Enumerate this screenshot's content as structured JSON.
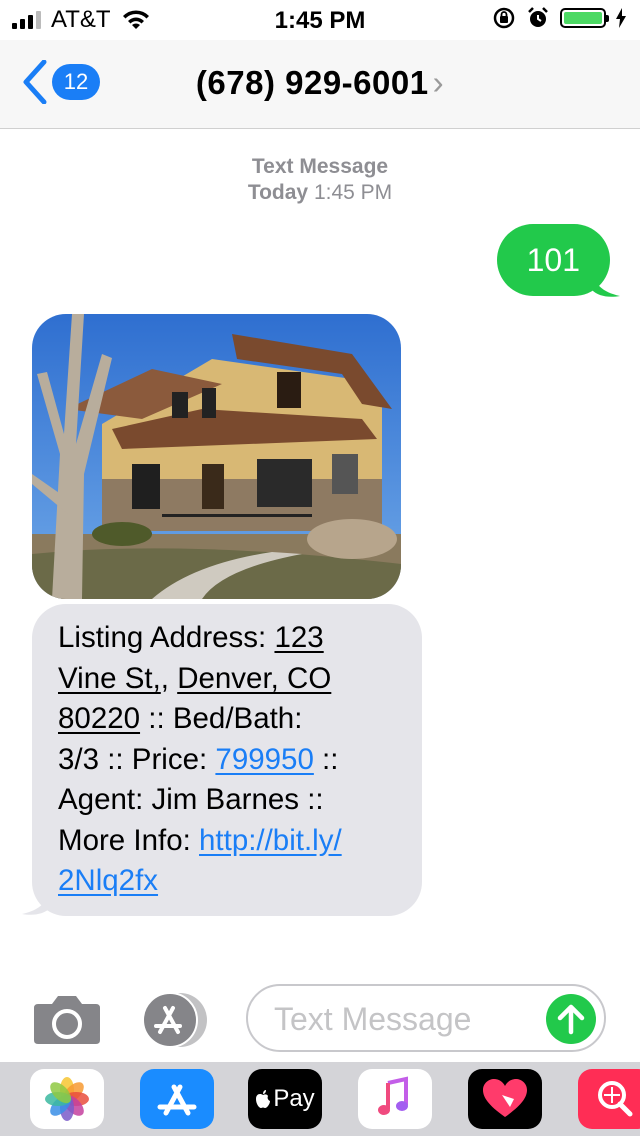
{
  "status_bar": {
    "carrier": "AT&T",
    "time": "1:45 PM",
    "battery_color": "#4cd964"
  },
  "nav": {
    "back_count": "12",
    "contact": "(678) 929-6001",
    "chevron": "›"
  },
  "timestamp": {
    "label": "Text Message",
    "day": "Today",
    "time": "1:45 PM"
  },
  "messages": {
    "outgoing": {
      "text": "101"
    },
    "incoming": {
      "image": "house-photo",
      "parts": {
        "p1": "Listing Address: ",
        "addr_line1": "123",
        "addr_line2a": "Vine St,",
        "addr_sep": ", ",
        "addr_line2b": "Denver, CO",
        "addr_line3": "80220",
        "p2": " :: Bed/Bath:",
        "p3": "3/3 :: Price: ",
        "price": "799950",
        "p4": " ::",
        "p5": "Agent: Jim Barnes ::",
        "p6": "More Info: ",
        "link_a": "http://bit.ly/",
        "link_b": "2Nlq2fx"
      }
    }
  },
  "composer": {
    "placeholder": "Text Message",
    "camera_icon": "camera-icon",
    "apps_icon": "app-store-icon",
    "send_icon": "send-arrow-icon"
  },
  "app_drawer": {
    "items": [
      "Photos",
      "App Store",
      "Apple Pay",
      "Music",
      "Digital Touch",
      "Images"
    ],
    "apple_pay_label": "Pay",
    "colors": {
      "app_store": "#1a8cff",
      "apple_pay": "#000000",
      "digital_touch": "#000000",
      "images": "#ff2d55",
      "accent_blue": "#1a7ef6",
      "sms_green": "#22c94b"
    }
  }
}
